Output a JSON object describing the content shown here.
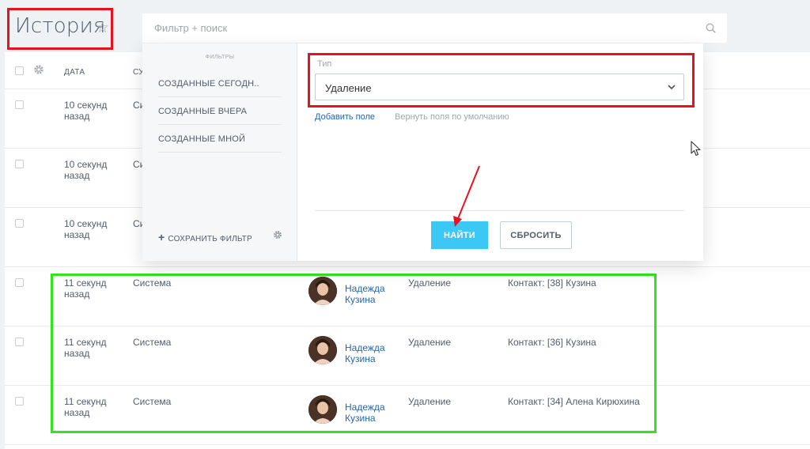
{
  "header": {
    "title": "История",
    "star_icon": "star-icon",
    "search_placeholder": "Фильтр + поиск"
  },
  "table": {
    "columns": [
      "Дата",
      "Су"
    ],
    "rows": [
      {
        "date": "10 секунд назад",
        "subject": "Си",
        "user": "",
        "type": "",
        "object": ""
      },
      {
        "date": "10 секунд назад",
        "subject": "Си",
        "user": "",
        "type": "",
        "object": ""
      },
      {
        "date": "10 секунд назад",
        "subject": "Си",
        "user": "",
        "type": "",
        "object": ""
      },
      {
        "date": "11 секунд назад",
        "subject": "Система",
        "user": "Надежда Кузина",
        "type": "Удаление",
        "object": "Контакт: [38] Кузина"
      },
      {
        "date": "11 секунд назад",
        "subject": "Система",
        "user": "Надежда Кузина",
        "type": "Удаление",
        "object": "Контакт: [36] Кузина"
      },
      {
        "date": "11 секунд назад",
        "subject": "Система",
        "user": "Надежда Кузина",
        "type": "Удаление",
        "object": "Контакт: [34] Алена Кирюхина"
      }
    ]
  },
  "filter": {
    "presets_title": "Фильтры",
    "presets": [
      "Созданные сегодн..",
      "Созданные вчера",
      "Созданные мной"
    ],
    "save_filter_label": "Сохранить фильтр",
    "field_label": "Тип",
    "field_value": "Удаление",
    "add_field": "Добавить поле",
    "reset_fields": "Вернуть поля по умолчанию",
    "find_button": "Найти",
    "reset_button": "Сбросить"
  },
  "colors": {
    "accent": "#3bc8f5",
    "link": "#2067b0",
    "highlight_red": "#e8121c",
    "highlight_green": "#2fe51b"
  }
}
